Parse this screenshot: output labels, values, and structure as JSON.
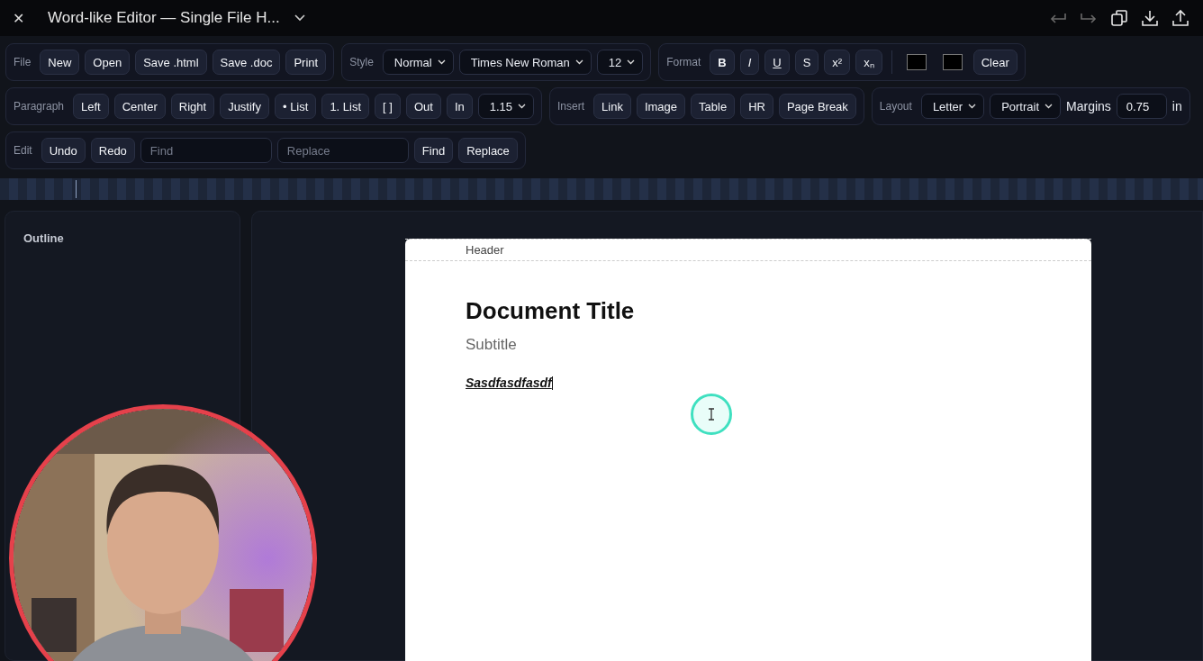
{
  "window": {
    "title": "Word-like Editor — Single File H...",
    "close": "✕"
  },
  "actions": [
    {
      "kind": "undo",
      "disabled": true
    },
    {
      "kind": "redo",
      "disabled": true
    },
    {
      "kind": "copy",
      "disabled": false
    },
    {
      "kind": "download",
      "disabled": false
    },
    {
      "kind": "upload",
      "disabled": false
    }
  ],
  "toolbar_rows": [
    [
      {
        "label": "File",
        "items": [
          {
            "kind": "button",
            "text": "New"
          },
          {
            "kind": "button",
            "text": "Open"
          },
          {
            "kind": "button",
            "text": "Save .html"
          },
          {
            "kind": "button",
            "text": "Save .doc"
          },
          {
            "kind": "button",
            "text": "Print"
          }
        ]
      },
      {
        "label": "Style",
        "items": [
          {
            "kind": "select",
            "value": "Normal"
          },
          {
            "kind": "select",
            "value": "Times New Roman"
          },
          {
            "kind": "select",
            "value": "12"
          }
        ]
      },
      {
        "label": "Format",
        "items": [
          {
            "kind": "button",
            "text": "B"
          },
          {
            "kind": "button",
            "text": "I"
          },
          {
            "kind": "button",
            "text": "U"
          },
          {
            "kind": "button",
            "text": "S"
          },
          {
            "kind": "button",
            "text": "x²"
          },
          {
            "kind": "button",
            "text": "xₙ"
          },
          {
            "kind": "separator"
          },
          {
            "kind": "swatch",
            "color": "#000000"
          },
          {
            "kind": "swatch",
            "color": "#000000"
          },
          {
            "kind": "button",
            "text": "Clear"
          }
        ]
      }
    ],
    [
      {
        "label": "Paragraph",
        "items": [
          {
            "kind": "button",
            "text": "Left"
          },
          {
            "kind": "button",
            "text": "Center"
          },
          {
            "kind": "button",
            "text": "Right"
          },
          {
            "kind": "button",
            "text": "Justify"
          },
          {
            "kind": "button",
            "text": "• List"
          },
          {
            "kind": "button",
            "text": "1. List"
          },
          {
            "kind": "button",
            "text": "[ ]"
          },
          {
            "kind": "button",
            "text": "Out"
          },
          {
            "kind": "button",
            "text": "In"
          },
          {
            "kind": "select",
            "value": "1.15"
          }
        ]
      },
      {
        "label": "Insert",
        "items": [
          {
            "kind": "button",
            "text": "Link"
          },
          {
            "kind": "button",
            "text": "Image"
          },
          {
            "kind": "button",
            "text": "Table"
          },
          {
            "kind": "button",
            "text": "HR"
          },
          {
            "kind": "button",
            "text": "Page Break"
          }
        ]
      },
      {
        "label": "Layout",
        "items": [
          {
            "kind": "select",
            "value": "Letter"
          },
          {
            "kind": "select",
            "value": "Portrait"
          },
          {
            "kind": "text",
            "text": "Margins"
          },
          {
            "kind": "field",
            "value": "0.75"
          },
          {
            "kind": "text",
            "text": "in"
          }
        ]
      }
    ],
    [
      {
        "label": "Edit",
        "items": [
          {
            "kind": "button",
            "text": "Undo"
          },
          {
            "kind": "button",
            "text": "Redo"
          },
          {
            "kind": "field",
            "placeholder": "Find"
          },
          {
            "kind": "field",
            "placeholder": "Replace"
          },
          {
            "kind": "button",
            "text": "Find"
          },
          {
            "kind": "button",
            "text": "Replace"
          }
        ]
      }
    ]
  ],
  "outline": {
    "title": "Outline"
  },
  "document": {
    "header": "Header",
    "title": "Document Title",
    "subtitle": "Subtitle",
    "paragraph": "Sasdfasdfasdf"
  }
}
